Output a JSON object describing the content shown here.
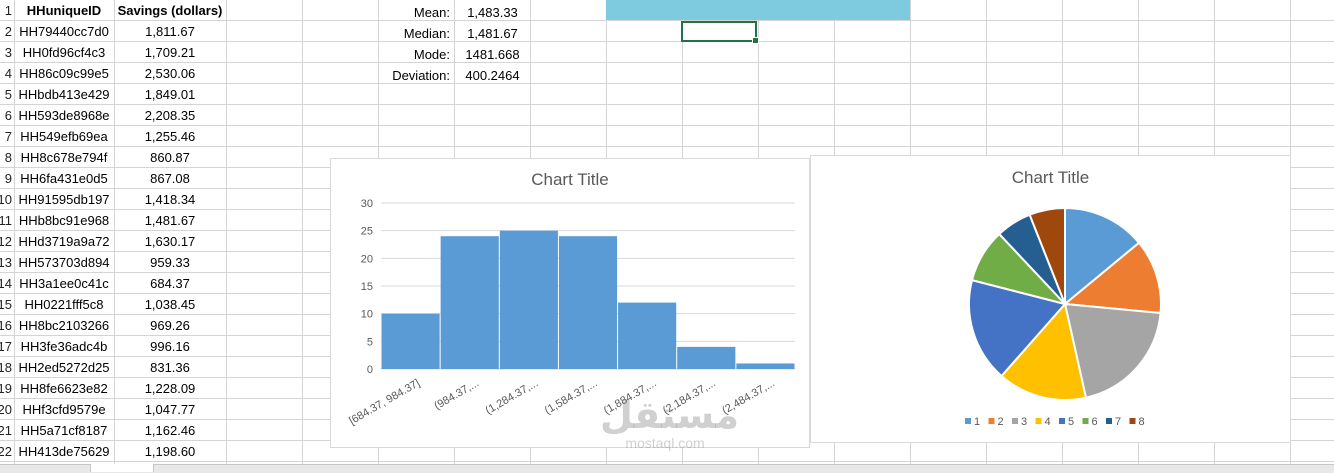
{
  "sheet": {
    "headers": {
      "id": "HHuniqueID",
      "savings": "Savings (dollars)"
    },
    "rows": [
      {
        "num": "1",
        "id": "",
        "val": ""
      },
      {
        "num": "2",
        "id": "HH79440cc7d0",
        "val": "1,811.67"
      },
      {
        "num": "3",
        "id": "HH0fd96cf4c3",
        "val": "1,709.21"
      },
      {
        "num": "4",
        "id": "HH86c09c99e5",
        "val": "2,530.06"
      },
      {
        "num": "5",
        "id": "HHbdb413e429",
        "val": "1,849.01"
      },
      {
        "num": "6",
        "id": "HH593de8968e",
        "val": "2,208.35"
      },
      {
        "num": "7",
        "id": "HH549efb69ea",
        "val": "1,255.46"
      },
      {
        "num": "8",
        "id": "HH8c678e794f",
        "val": "860.87"
      },
      {
        "num": "9",
        "id": "HH6fa431e0d5",
        "val": "867.08"
      },
      {
        "num": "10",
        "id": "HH91595db197",
        "val": "1,418.34"
      },
      {
        "num": "11",
        "id": "HHb8bc91e968",
        "val": "1,481.67"
      },
      {
        "num": "12",
        "id": "HHd3719a9a72",
        "val": "1,630.17"
      },
      {
        "num": "13",
        "id": "HH573703d894",
        "val": "959.33"
      },
      {
        "num": "14",
        "id": "HH3a1ee0c41c",
        "val": "684.37"
      },
      {
        "num": "15",
        "id": "HH0221fff5c8",
        "val": "1,038.45"
      },
      {
        "num": "16",
        "id": "HH8bc2103266",
        "val": "969.26"
      },
      {
        "num": "17",
        "id": "HH3fe36adc4b",
        "val": "996.16"
      },
      {
        "num": "18",
        "id": "HH2ed5272d25",
        "val": "831.36"
      },
      {
        "num": "19",
        "id": "HH8fe6623e82",
        "val": "1,228.09"
      },
      {
        "num": "20",
        "id": "HHf3cfd9579e",
        "val": "1,047.77"
      },
      {
        "num": "21",
        "id": "HH5a71cf8187",
        "val": "1,162.46"
      },
      {
        "num": "22",
        "id": "HH413de75629",
        "val": "1,198.60"
      }
    ]
  },
  "stats": [
    {
      "label": "Mean:",
      "value": "1,483.33"
    },
    {
      "label": "Median:",
      "value": "1,481.67"
    },
    {
      "label": "Mode:",
      "value": "1481.668"
    },
    {
      "label": "Deviation:",
      "value": "400.2464"
    }
  ],
  "colors": {
    "gridline": "#d4d4d4",
    "bar": "#5b9bd5",
    "header_band": "#7ecbe0",
    "selection": "#217346"
  },
  "chart_data": [
    {
      "type": "bar",
      "title": "Chart Title",
      "categories": [
        "[684.37, 984.37]",
        "(984.37,...",
        "(1,284.37,...",
        "(1,584.37,...",
        "(1,884.37,...",
        "(2,184.37,...",
        "(2,484.37,..."
      ],
      "values": [
        10,
        24,
        25,
        24,
        12,
        4,
        1
      ],
      "ylim": [
        0,
        30
      ],
      "yticks": [
        "0",
        "5",
        "10",
        "15",
        "20",
        "25",
        "30"
      ],
      "grid": true
    },
    {
      "type": "pie",
      "title": "Chart Title",
      "labels": [
        "1",
        "2",
        "3",
        "4",
        "5",
        "6",
        "7",
        "8"
      ],
      "values": [
        14,
        12.5,
        20,
        15,
        17.5,
        9,
        6,
        6
      ],
      "colors": [
        "#5b9bd5",
        "#ed7d31",
        "#a5a5a5",
        "#ffc000",
        "#4472c4",
        "#70ad47",
        "#255e91",
        "#9e480e"
      ],
      "legend": "bottom"
    }
  ],
  "watermark": {
    "arabic": "مستقل",
    "latin": "mostaql.com"
  }
}
